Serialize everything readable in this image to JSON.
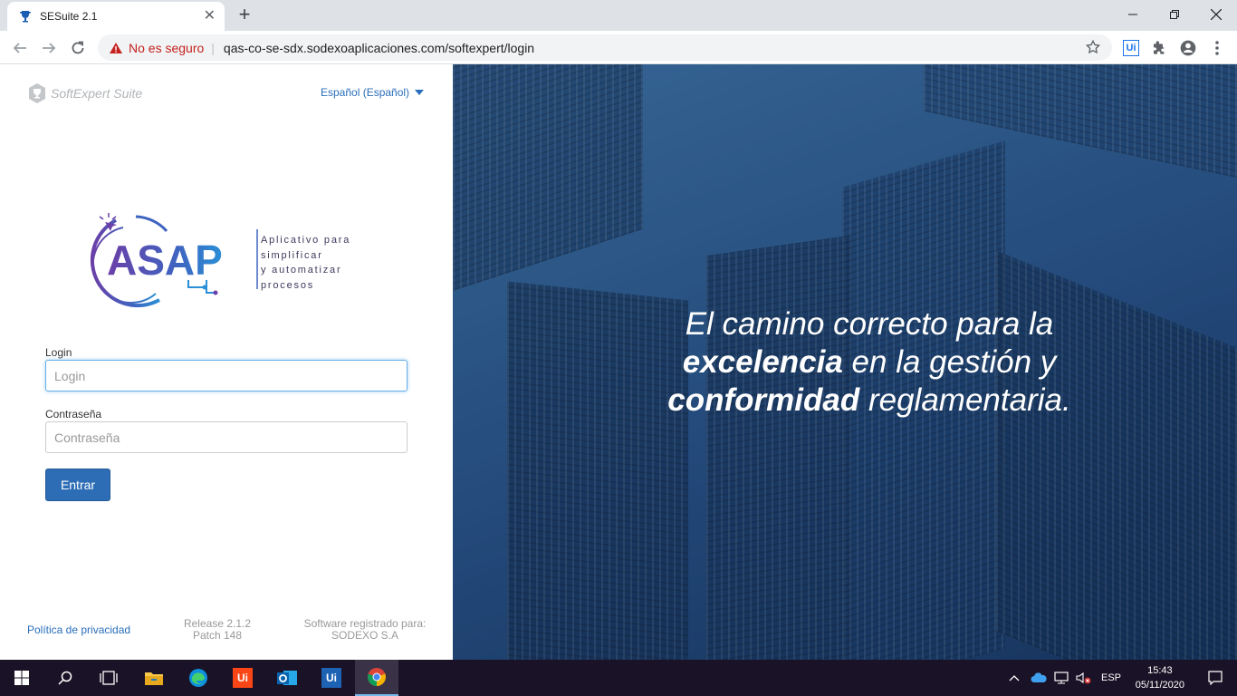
{
  "browser": {
    "tab_title": "SESuite 2.1",
    "security_label": "No es seguro",
    "url": "qas-co-se-sdx.sodexoaplicaciones.com/softexpert/login"
  },
  "header": {
    "brand": "SoftExpert Suite",
    "language": "Español (Español)"
  },
  "logo": {
    "name": "ASAP",
    "tagline_lines": [
      "Aplicativo para",
      "simplificar",
      "y automatizar",
      "procesos"
    ]
  },
  "form": {
    "login_label": "Login",
    "login_placeholder": "Login",
    "password_label": "Contraseña",
    "password_placeholder": "Contraseña",
    "submit_label": "Entrar"
  },
  "footer": {
    "privacy": "Política de privacidad",
    "release": "Release 2.1.2",
    "patch": "Patch 148",
    "registered_label": "Software registrado para:",
    "registered_to": "SODEXO S.A"
  },
  "slogan": {
    "line1": "El camino correcto para la",
    "bold1": "excelencia",
    "line2_rest": " en la gestión y",
    "bold2": "conformidad",
    "line3_rest": " reglamentaria."
  },
  "taskbar": {
    "language": "ESP",
    "time": "15:43",
    "date": "05/11/2020"
  },
  "colors": {
    "primary_button": "#2d6db5",
    "link": "#2a6ebb",
    "warning": "#c5221f",
    "logo_purple": "#5b3fa0",
    "logo_blue": "#2a8fd6"
  }
}
